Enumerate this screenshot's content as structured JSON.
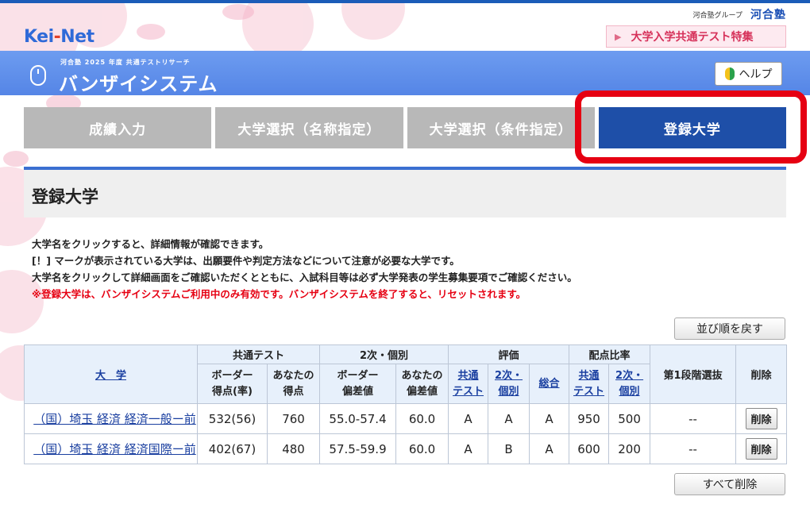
{
  "header": {
    "group_label": "河合塾グループ",
    "group_logo": "河合塾",
    "site_logo_left": "Kei",
    "site_logo_dash": "-",
    "site_logo_right": "Net",
    "feature_link": "大学入学共通テスト特集"
  },
  "banner": {
    "subtitle": "河合塾 2025 年度 共通テストリサーチ",
    "title": "バンザイシステム",
    "help_label": "ヘルプ"
  },
  "tabs": [
    {
      "label": "成績入力"
    },
    {
      "label": "大学選択（名称指定）"
    },
    {
      "label": "大学選択（条件指定）"
    },
    {
      "label": "登録大学"
    }
  ],
  "page_title": "登録大学",
  "notes": [
    "大学名をクリックすると、詳細情報が確認できます。",
    "[！] マークが表示されている大学は、出願要件や判定方法などについて注意が必要な大学です。",
    "大学名をクリックして詳細画面をご確認いただくとともに、入試科目等は必ず大学発表の学生募集要項でご確認ください。"
  ],
  "warning": "※登録大学は、バンザイシステムご利用中のみ有効です。バンザイシステムを終了すると、リセットされます。",
  "sort_button": "並び順を戻す",
  "delete_all_button": "すべて削除",
  "table": {
    "headers": {
      "university": "大　学",
      "common_test": "共通テスト",
      "second": "2次・個別",
      "evaluation": "評価",
      "ratio": "配点比率",
      "stage1": "第1段階選抜",
      "delete": "削除",
      "ct_border_1": "ボーダー",
      "ct_border_2": "得点(率)",
      "ct_yours_1": "あなたの",
      "ct_yours_2": "得点",
      "sd_border_1": "ボーダー",
      "sd_border_2": "偏差値",
      "sd_yours_1": "あなたの",
      "sd_yours_2": "偏差値",
      "ev_common_1": "共通",
      "ev_common_2": "テスト",
      "ev_second_1": "2次・",
      "ev_second_2": "個別",
      "ev_total": "総合",
      "ra_common_1": "共通",
      "ra_common_2": "テスト",
      "ra_second_1": "2次・",
      "ra_second_2": "個別"
    },
    "rows": [
      {
        "university": "（国）埼玉 経済 経済一般ー前",
        "ct_border": "532(56)",
        "ct_yours": "760",
        "sd_border": "55.0-57.4",
        "sd_yours": "60.0",
        "ev_common": "A",
        "ev_second": "A",
        "ev_total": "A",
        "ra_common": "950",
        "ra_second": "500",
        "stage1": "--",
        "delete": "削除"
      },
      {
        "university": "（国）埼玉 経済 経済国際ー前",
        "ct_border": "402(67)",
        "ct_yours": "480",
        "sd_border": "57.5-59.9",
        "sd_yours": "60.0",
        "ev_common": "A",
        "ev_second": "B",
        "ev_total": "A",
        "ra_common": "600",
        "ra_second": "200",
        "stage1": "--",
        "delete": "削除"
      }
    ]
  },
  "colors": {
    "active_tab": "#1e4fa8",
    "inactive_tab": "#b8b8b8",
    "banner": "#5585e6",
    "highlight": "#e60012",
    "warning": "#e60012"
  }
}
